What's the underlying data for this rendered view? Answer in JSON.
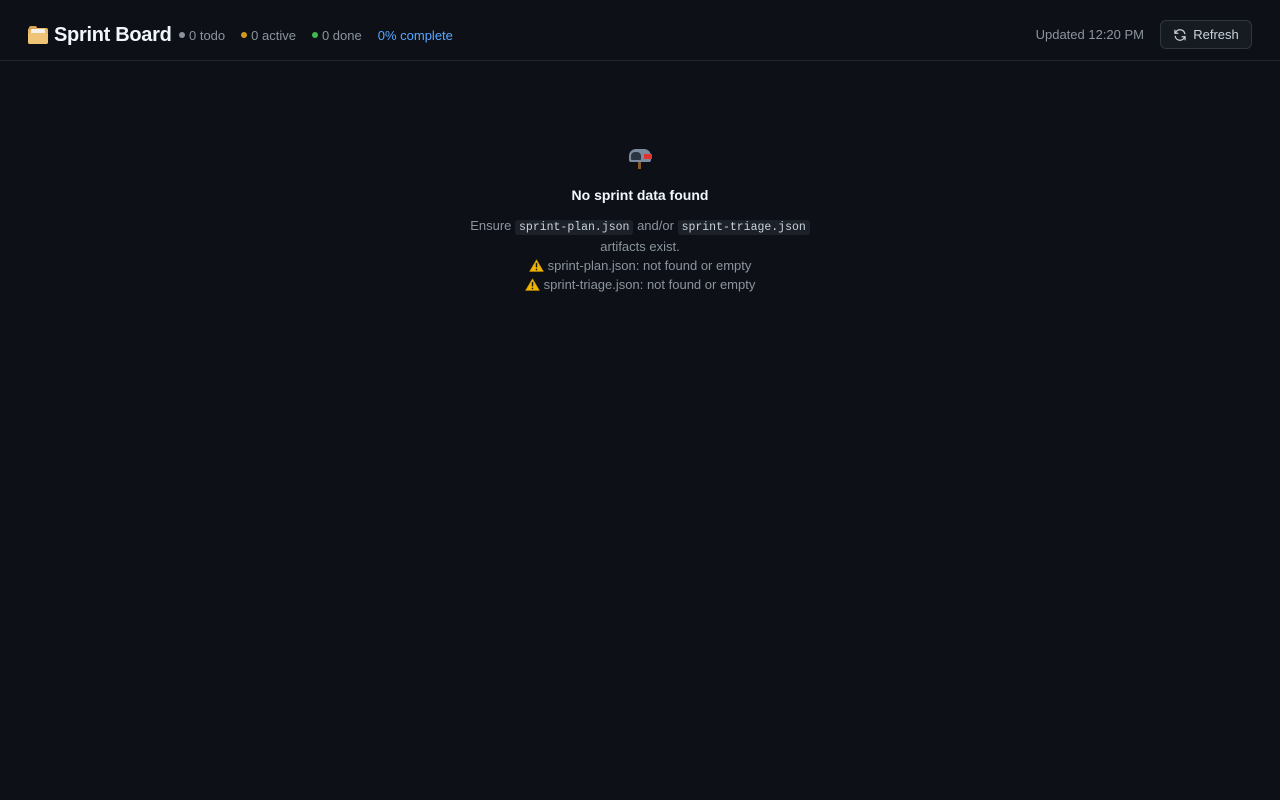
{
  "header": {
    "title": "Sprint Board",
    "icon": "card-index-dividers-icon",
    "stats": [
      {
        "label": "0 todo",
        "color": "#8b949e"
      },
      {
        "label": "0 active",
        "color": "#d29922"
      },
      {
        "label": "0 done",
        "color": "#3fb950"
      }
    ],
    "progress_label": "0% complete",
    "progress_value": 0,
    "updated": "Updated 12:20 PM",
    "refresh_label": "Refresh"
  },
  "empty_state": {
    "icon": "mailbox-icon",
    "title": "No sprint data found",
    "message_prefix": "Ensure",
    "file1": "sprint-plan.json",
    "message_middle": "and/or",
    "file2": "sprint-triage.json",
    "message_suffix": "artifacts exist.",
    "warnings": [
      "sprint-plan.json: not found or empty",
      "sprint-triage.json: not found or empty"
    ]
  },
  "colors": {
    "background": "#0d1117",
    "accent": "#58a6ff",
    "warning": "#f0b400"
  }
}
